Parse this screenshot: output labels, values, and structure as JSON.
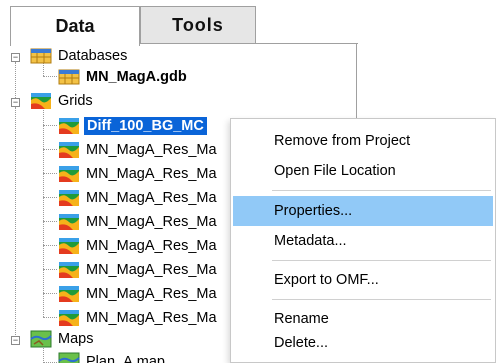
{
  "tabs": [
    {
      "label": "Data"
    },
    {
      "label": "Tools"
    }
  ],
  "tree": {
    "databases": {
      "label": "Databases",
      "expander": "−"
    },
    "database_items": [
      {
        "label": "MN_MagA.gdb"
      }
    ],
    "grids": {
      "label": "Grids",
      "expander": "−"
    },
    "grid_items": [
      {
        "label": "Diff_100_BG_MC",
        "selected": true
      },
      {
        "label": "MN_MagA_Res_Ma"
      },
      {
        "label": "MN_MagA_Res_Ma"
      },
      {
        "label": "MN_MagA_Res_Ma"
      },
      {
        "label": "MN_MagA_Res_Ma"
      },
      {
        "label": "MN_MagA_Res_Ma"
      },
      {
        "label": "MN_MagA_Res_Ma"
      },
      {
        "label": "MN_MagA_Res_Ma"
      },
      {
        "label": "MN_MagA_Res_Ma"
      }
    ],
    "maps": {
      "label": "Maps",
      "expander": "−"
    },
    "map_items": [
      {
        "label": "Plan_A.map"
      }
    ]
  },
  "context_menu": {
    "items": [
      {
        "label": "Remove from Project"
      },
      {
        "label": "Open File Location"
      },
      {
        "label": "Properties...",
        "highlighted": true
      },
      {
        "label": "Metadata..."
      },
      {
        "label": "Export to OMF..."
      },
      {
        "label": "Rename"
      },
      {
        "label": "Delete..."
      }
    ]
  },
  "colors": {
    "selection": "#0a64d8",
    "menu_highlight": "#91c9f7"
  }
}
